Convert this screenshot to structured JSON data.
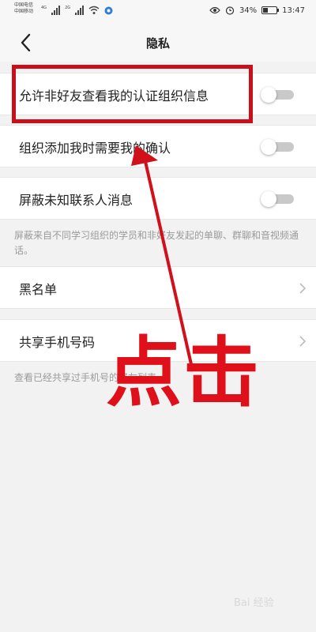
{
  "status_bar": {
    "carrier1": "中国电信",
    "carrier2": "中国移动",
    "net1": "4G",
    "net2": "2G",
    "battery": "34%",
    "battery_level": 0.34,
    "time": "13:47"
  },
  "header": {
    "title": "隐私",
    "back_icon": "chevron-left-icon"
  },
  "settings": {
    "allow_view": {
      "label": "允许非好友查看我的认证组织信息",
      "enabled": false
    },
    "confirm_add": {
      "label": "组织添加我时需要我的确认",
      "enabled": false
    },
    "block_unknown": {
      "label": "屏蔽未知联系人消息",
      "enabled": false
    },
    "block_note": "屏蔽来自不同学习组织的学员和非好友发起的单聊、群聊和音视频通话。",
    "blacklist": {
      "label": "黑名单"
    },
    "share_phone": {
      "label": "共享手机号码"
    },
    "share_note": "查看已经共享过手机号的好友列表"
  },
  "annotation": {
    "text": "点击",
    "color": "#e0101a",
    "box_color": "#c8101a"
  },
  "watermark": "Bai 经验"
}
